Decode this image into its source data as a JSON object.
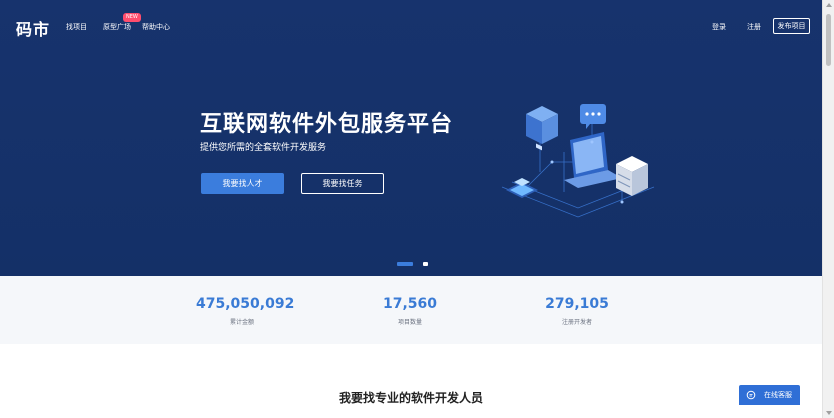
{
  "nav": {
    "logo": "码市",
    "links": [
      "找项目",
      "原型广场",
      "帮助中心"
    ],
    "badge": "NEW",
    "login": "登录",
    "register": "注册",
    "publish": "发布项目"
  },
  "hero": {
    "title": "互联网软件外包服务平台",
    "subtitle": "提供您所需的全套软件开发服务",
    "primary_button": "我要找人才",
    "secondary_button": "我要找任务",
    "carousel": {
      "active_index": 0,
      "count": 2
    }
  },
  "stats": [
    {
      "value": "475,050,092",
      "label": "累计金额"
    },
    {
      "value": "17,560",
      "label": "项目数量"
    },
    {
      "value": "279,105",
      "label": "注册开发者"
    }
  ],
  "section": {
    "title": "我要找专业的软件开发人员"
  },
  "service": {
    "label": "在线客服"
  },
  "colors": {
    "hero_bg": "#17336d",
    "accent": "#3b7ddd",
    "stat_value": "#3a7bd5",
    "badge": "#ff4d6d"
  }
}
